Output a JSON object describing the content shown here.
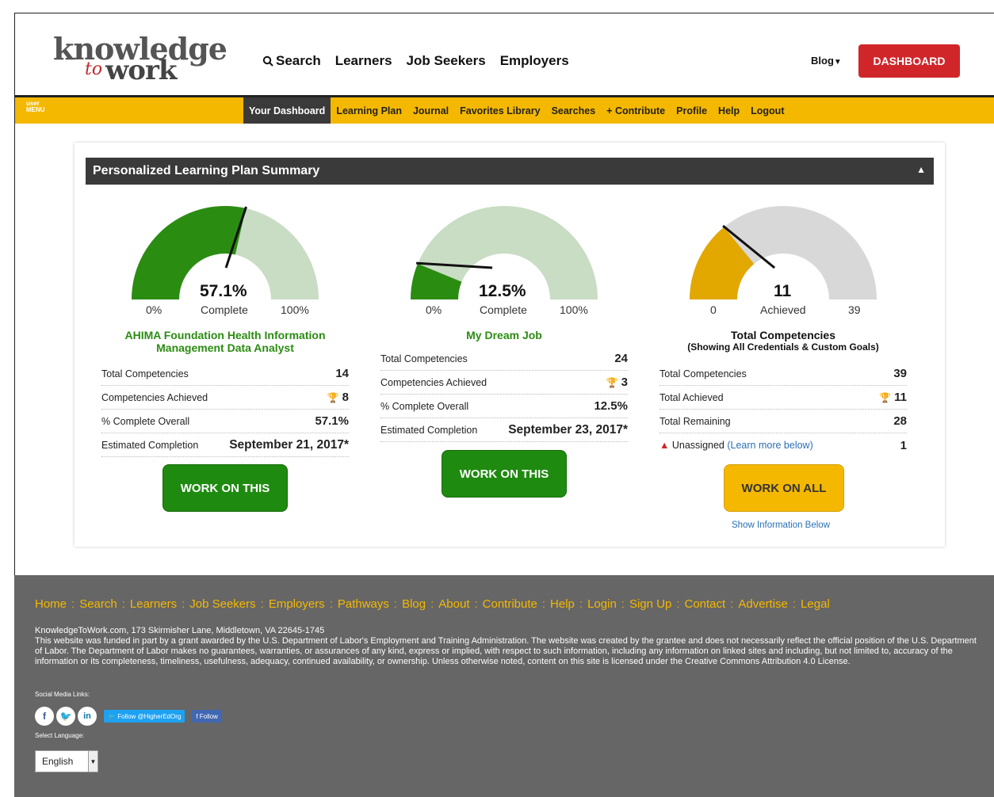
{
  "header": {
    "logo_line1": "knowledge",
    "logo_to": "to",
    "logo_line2": "work",
    "nav": {
      "search": "Search",
      "learners": "Learners",
      "job_seekers": "Job Seekers",
      "employers": "Employers"
    },
    "blog": "Blog",
    "dashboard_button": "DASHBOARD"
  },
  "usermenu": {
    "tag_line1": "user",
    "tag_line2": "MENU",
    "items": [
      "Your Dashboard",
      "Learning Plan",
      "Journal",
      "Favorites Library",
      "Searches",
      "+ Contribute",
      "Profile",
      "Help",
      "Logout"
    ],
    "active": "Your Dashboard"
  },
  "panel": {
    "title": "Personalized Learning Plan Summary",
    "plans": [
      {
        "gauge_value": "57.1%",
        "gauge_label": "Complete",
        "gauge_min": "0%",
        "gauge_max": "100%",
        "fill_fraction": 0.571,
        "title_line1": "AHIMA Foundation Health Information",
        "title_line2": "Management Data Analyst",
        "rows": [
          {
            "label": "Total Competencies",
            "value": "14"
          },
          {
            "label": "Competencies Achieved",
            "value": "8"
          },
          {
            "label": "% Complete Overall",
            "value": "57.1%"
          },
          {
            "label": "Estimated Completion",
            "value": "September 21, 2017*"
          }
        ],
        "button": "WORK ON THIS"
      },
      {
        "gauge_value": "12.5%",
        "gauge_label": "Complete",
        "gauge_min": "0%",
        "gauge_max": "100%",
        "fill_fraction": 0.125,
        "title_line1": "My Dream Job",
        "rows": [
          {
            "label": "Total Competencies",
            "value": "24"
          },
          {
            "label": "Competencies Achieved",
            "value": "3"
          },
          {
            "label": "% Complete Overall",
            "value": "12.5%"
          },
          {
            "label": "Estimated Completion",
            "value": "September 23, 2017*"
          }
        ],
        "button": "WORK ON THIS"
      },
      {
        "gauge_value": "11",
        "gauge_label": "Achieved",
        "gauge_min": "0",
        "gauge_max": "39",
        "fill_fraction": 0.282,
        "title_line1": "Total Competencies",
        "title_line2": "(Showing All Credentials & Custom Goals)",
        "rows": [
          {
            "label": "Total Competencies",
            "value": "39"
          },
          {
            "label": "Total Achieved",
            "value": "11"
          },
          {
            "label": "Total Remaining",
            "value": "28"
          },
          {
            "label": "Unassigned",
            "link": "(Learn more below)",
            "value": "1"
          }
        ],
        "button": "WORK ON ALL",
        "below_link": "Show Information Below"
      }
    ]
  },
  "colors": {
    "green": "#2b8c12",
    "green_light": "#c9dcc4",
    "gold": "#f5b800",
    "gray_light": "#d8d8d8",
    "red": "#d0262a"
  },
  "footer": {
    "links": [
      "Home",
      "Search",
      "Learners",
      "Job Seekers",
      "Employers",
      "Pathways",
      "Blog",
      "About",
      "Contribute",
      "Help",
      "Login",
      "Sign Up",
      "Contact",
      "Advertise",
      "Legal"
    ],
    "address": "KnowledgeToWork.com, 173 Skirmisher Lane, Middletown, VA 22645-1745",
    "disclaimer": "This website was funded in part by a grant awarded by the U.S. Department of Labor's Employment and Training Administration. The website was created by the grantee and does not necessarily reflect the official position of the U.S. Department of Labor. The Department of Labor makes no guarantees, warranties, or assurances of any kind, express or implied, with respect to such information, including any information on linked sites and including, but not limited to, accuracy of the information or its completeness, timeliness, usefulness, adequacy, continued availability, or ownership. Unless otherwise noted, content on this site is licensed under the Creative Commons Attribution 4.0 License.",
    "social_label": "Social Media Links:",
    "follow_twitter": "Follow @HigherEdOrg",
    "follow_facebook": "Follow",
    "language_label": "Select Language:",
    "language_value": "English"
  }
}
